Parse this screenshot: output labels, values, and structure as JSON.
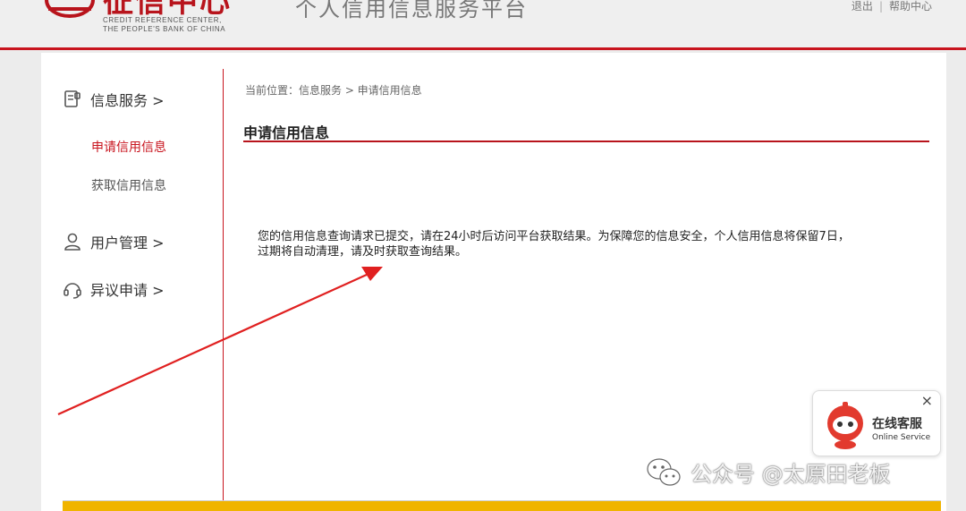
{
  "header": {
    "logo_cn": "征信中心",
    "logo_en_line1": "CREDIT REFERENCE CENTER,",
    "logo_en_line2": "THE PEOPLE'S BANK OF CHINA",
    "platform_title": "个人信用信息服务平台",
    "links": {
      "logout": "退出",
      "separator": "|",
      "help": "帮助中心"
    }
  },
  "sidebar": {
    "groups": [
      {
        "label": "信息服务 >",
        "icon": "document-icon"
      },
      {
        "label": "用户管理 >",
        "icon": "user-icon"
      },
      {
        "label": "异议申请 >",
        "icon": "headset-icon"
      }
    ],
    "sub_items": [
      {
        "label": "申请信用信息",
        "active": true
      },
      {
        "label": "获取信用信息",
        "active": false
      }
    ]
  },
  "main": {
    "breadcrumb": "当前位置：信息服务 > 申请信用信息",
    "section_title": "申请信用信息",
    "message_line1": "您的信用信息查询请求已提交，请在24小时后访问平台获取结果。为保障您的信息安全，个人信用信息将保留7日，",
    "message_line2": "过期将自动清理，请及时获取查询结果。"
  },
  "service_widget": {
    "label_cn": "在线客服",
    "label_en": "Online Service",
    "close": "×"
  },
  "watermark": {
    "text": "公众号 @太原田老板",
    "icon": "wechat-icon"
  },
  "colors": {
    "brand_red": "#c8141e",
    "footer_yellow": "#f0b400",
    "arrow": "#e02020"
  }
}
